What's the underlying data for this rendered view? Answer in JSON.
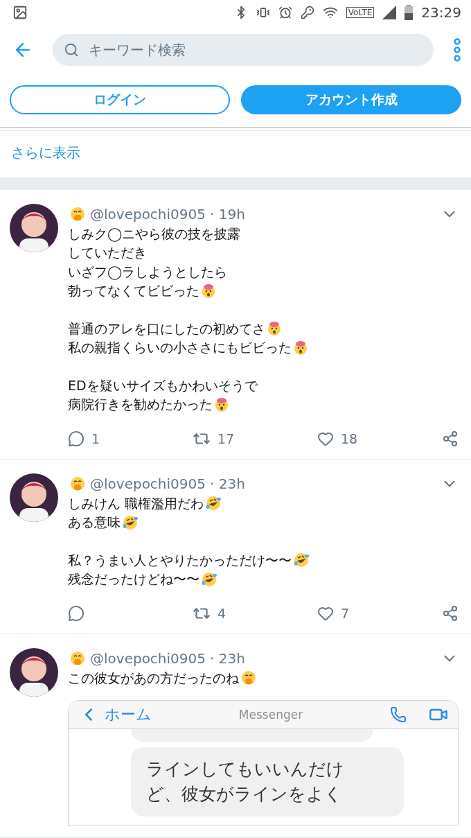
{
  "status_bar": {
    "time": "23:29",
    "network": "VoLTE"
  },
  "header": {
    "search": {
      "placeholder": "キーワード検索"
    }
  },
  "auth_buttons": [
    {
      "label": "ログイン",
      "kind": "outline"
    },
    {
      "label": "アカウント作成",
      "kind": "filled"
    }
  ],
  "show_more": "さらに表示",
  "tweets": [
    {
      "handle": "@lovepochi0905",
      "time": "· 19h",
      "paragraphs": [
        [
          {
            "text": "しみク◯ニやら彼の技を披露",
            "kind": "plain"
          },
          {
            "text": "していただき",
            "kind": "plain"
          },
          {
            "text": "いざフ◯ラしようとしたら",
            "kind": "plain"
          },
          {
            "text": "勃ってなくてビビった",
            "kind": "exploding"
          }
        ],
        [
          {
            "text": "普通のアレを口にしたの初めてさ",
            "kind": "exploding"
          },
          {
            "text": "私の親指くらいの小ささにもビビった",
            "kind": "exploding"
          }
        ],
        [
          {
            "text": "EDを疑いサイズもかわいそうで",
            "kind": "plain"
          },
          {
            "text": "病院行きを勧めたかった",
            "kind": "exploding"
          }
        ]
      ],
      "replies": "1",
      "retweets": "17",
      "likes": "18"
    },
    {
      "handle": "@lovepochi0905",
      "time": "· 23h",
      "paragraphs": [
        [
          {
            "text": "しみけん 職権濫用だわ",
            "kind": "laughing"
          },
          {
            "text": "ある意味",
            "kind": "laughing"
          }
        ],
        [
          {
            "text": "私？うまい人とやりたかっただけ〜〜",
            "kind": "laughing"
          },
          {
            "text": "残念だったけどね〜〜",
            "kind": "laughing"
          }
        ]
      ],
      "retweets": "4",
      "likes": "7"
    },
    {
      "handle": "@lovepochi0905",
      "time": "· 23h",
      "paragraphs": [
        [
          {
            "text": "この彼女があの方だったのね",
            "kind": "hand"
          }
        ]
      ],
      "media": {
        "back_label": "ホーム",
        "title": "Messenger",
        "bubbles": [
          {
            "kind": "cut"
          },
          {
            "kind": "full",
            "lines": [
              "ラインしてもいいんだけ",
              "ど、彼女がラインをよく"
            ]
          }
        ]
      }
    }
  ]
}
